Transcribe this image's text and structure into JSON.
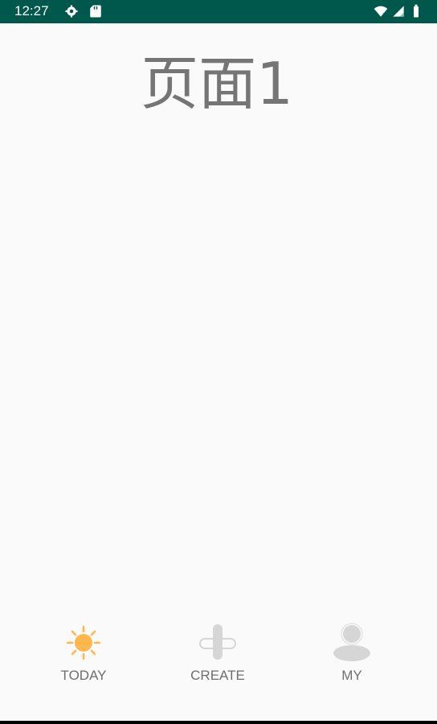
{
  "status_bar": {
    "time": "12:27",
    "bg_color": "#00574b",
    "icons": [
      "gear-icon",
      "sd-card-icon",
      "wifi-icon",
      "signal-icon",
      "battery-icon"
    ]
  },
  "page": {
    "title": "页面1"
  },
  "bottom_nav": {
    "items": [
      {
        "label": "TODAY",
        "icon": "sun-icon",
        "active": true
      },
      {
        "label": "CREATE",
        "icon": "plus-icon",
        "active": false
      },
      {
        "label": "MY",
        "icon": "person-icon",
        "active": false
      }
    ],
    "active_color": "#ffb74d",
    "inactive_color": "#d6d6d6"
  }
}
